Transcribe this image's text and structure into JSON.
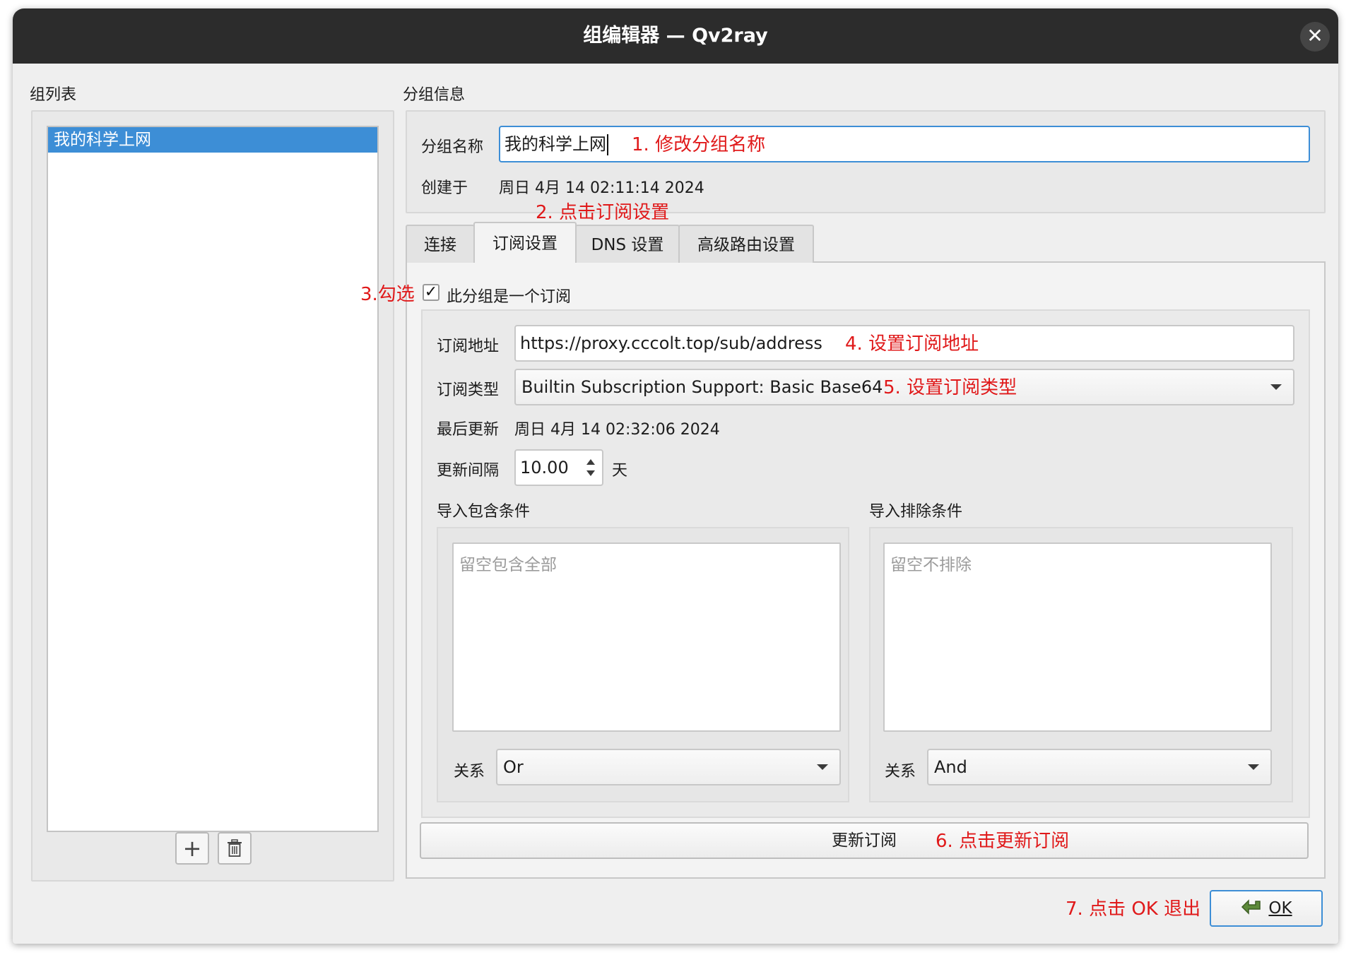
{
  "window": {
    "title": "组编辑器 — Qv2ray",
    "close_glyph": "✕"
  },
  "group_list": {
    "heading": "组列表",
    "items": [
      "我的科学上网"
    ],
    "add_glyph": "+",
    "delete_icon": "trash-icon"
  },
  "group_info": {
    "heading": "分组信息",
    "name_label": "分组名称",
    "name_value": "我的科学上网",
    "created_label": "创建于",
    "created_value": "周日 4月 14 02:11:14 2024"
  },
  "tabs": [
    {
      "label": "连接",
      "active": false
    },
    {
      "label": "订阅设置",
      "active": true
    },
    {
      "label": "DNS 设置",
      "active": false
    },
    {
      "label": "高级路由设置",
      "active": false
    }
  ],
  "subscription": {
    "checkbox_label": "此分组是一个订阅",
    "checkbox_checked": true,
    "check_glyph": "✓",
    "url_label": "订阅地址",
    "url_value": "https://proxy.cccolt.top/sub/address",
    "type_label": "订阅类型",
    "type_value": "Builtin Subscription Support: Basic Base64",
    "last_update_label": "最后更新",
    "last_update_value": "周日 4月 14 02:32:06 2024",
    "interval_label": "更新间隔",
    "interval_value": "10.00",
    "interval_unit": "天",
    "include_heading": "导入包含条件",
    "include_placeholder": "留空包含全部",
    "include_relation_label": "关系",
    "include_relation_value": "Or",
    "exclude_heading": "导入排除条件",
    "exclude_placeholder": "留空不排除",
    "exclude_relation_label": "关系",
    "exclude_relation_value": "And",
    "update_button": "更新订阅"
  },
  "ok_button": {
    "label": "OK",
    "icon": "arrow-icon"
  },
  "annotations": {
    "step1": "1. 修改分组名称",
    "step2": "2. 点击订阅设置",
    "step3": "3.勾选",
    "step4": "4. 设置订阅地址",
    "step5": "5. 设置订阅类型",
    "step6": "6. 点击更新订阅",
    "step7": "7. 点击 OK 退出"
  },
  "colors": {
    "titlebar": "#2c2c2c",
    "selection": "#3d8ed6",
    "annotation": "#e0191a",
    "window_bg": "#efefef"
  }
}
